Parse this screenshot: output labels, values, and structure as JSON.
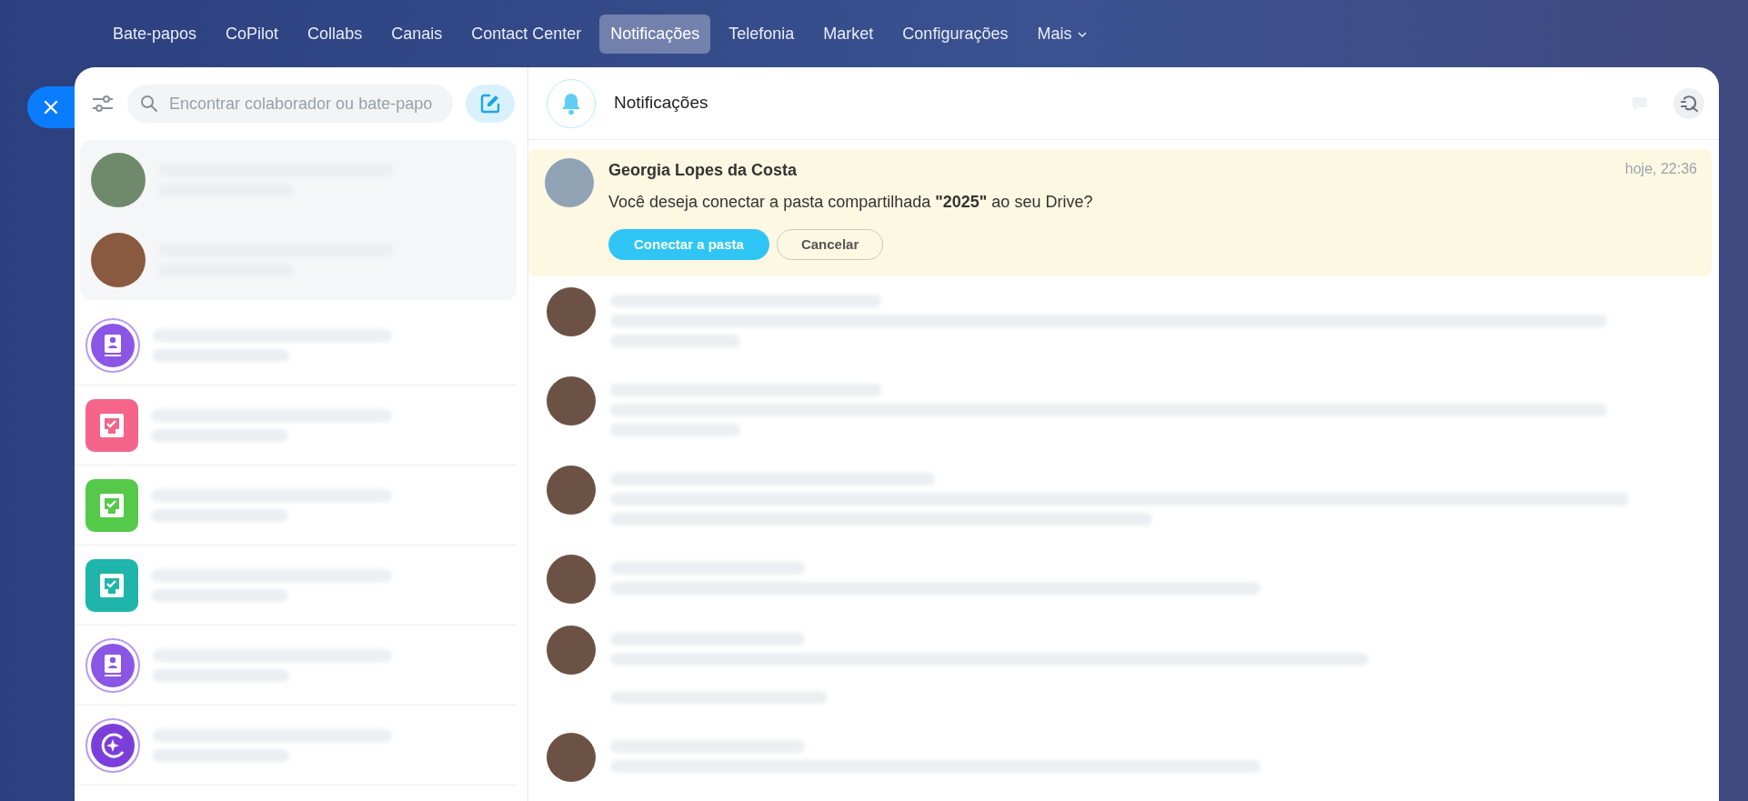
{
  "nav": {
    "items": [
      {
        "label": "Bate-papos",
        "selected": false,
        "caret": false
      },
      {
        "label": "CoPilot",
        "selected": false,
        "caret": false
      },
      {
        "label": "Collabs",
        "selected": false,
        "caret": false
      },
      {
        "label": "Canais",
        "selected": false,
        "caret": false
      },
      {
        "label": "Contact Center",
        "selected": false,
        "caret": false
      },
      {
        "label": "Notificações",
        "selected": true,
        "caret": false
      },
      {
        "label": "Telefonia",
        "selected": false,
        "caret": false
      },
      {
        "label": "Market",
        "selected": false,
        "caret": false
      },
      {
        "label": "Configurações",
        "selected": false,
        "caret": false
      },
      {
        "label": "Mais",
        "selected": false,
        "caret": true
      }
    ]
  },
  "search": {
    "placeholder": "Encontrar colaborador ou bate-papo"
  },
  "chat_list": [
    {
      "kind": "photo",
      "pinned": true,
      "color": "#6f8a6a"
    },
    {
      "kind": "photo",
      "pinned": true,
      "color": "#8a5a40"
    },
    {
      "kind": "contact",
      "pinned": false,
      "color": "#8b55e6"
    },
    {
      "kind": "task",
      "pinned": false,
      "color": "#f5648a"
    },
    {
      "kind": "task",
      "pinned": false,
      "color": "#55c94a"
    },
    {
      "kind": "task",
      "pinned": false,
      "color": "#1fb5ab"
    },
    {
      "kind": "contact",
      "pinned": false,
      "color": "#8b55e6"
    },
    {
      "kind": "copilot",
      "pinned": false,
      "color": "#7b3fd9"
    }
  ],
  "header": {
    "title": "Notificações"
  },
  "notification": {
    "sender": "Georgia Lopes da Costa",
    "time": "hoje, 22:36",
    "text": "Você deseja conectar a pasta compartilhada **\"2025\"** ao seu Drive?",
    "buttons": [
      {
        "label": "Conectar a pasta",
        "kind": "primary"
      },
      {
        "label": "Cancelar",
        "kind": "secondary"
      }
    ]
  },
  "messages": [
    {
      "kind": "long"
    },
    {
      "kind": "long"
    },
    {
      "kind": "medium"
    },
    {
      "kind": "short"
    },
    {
      "kind": "extra"
    },
    {
      "kind": "short"
    }
  ]
}
